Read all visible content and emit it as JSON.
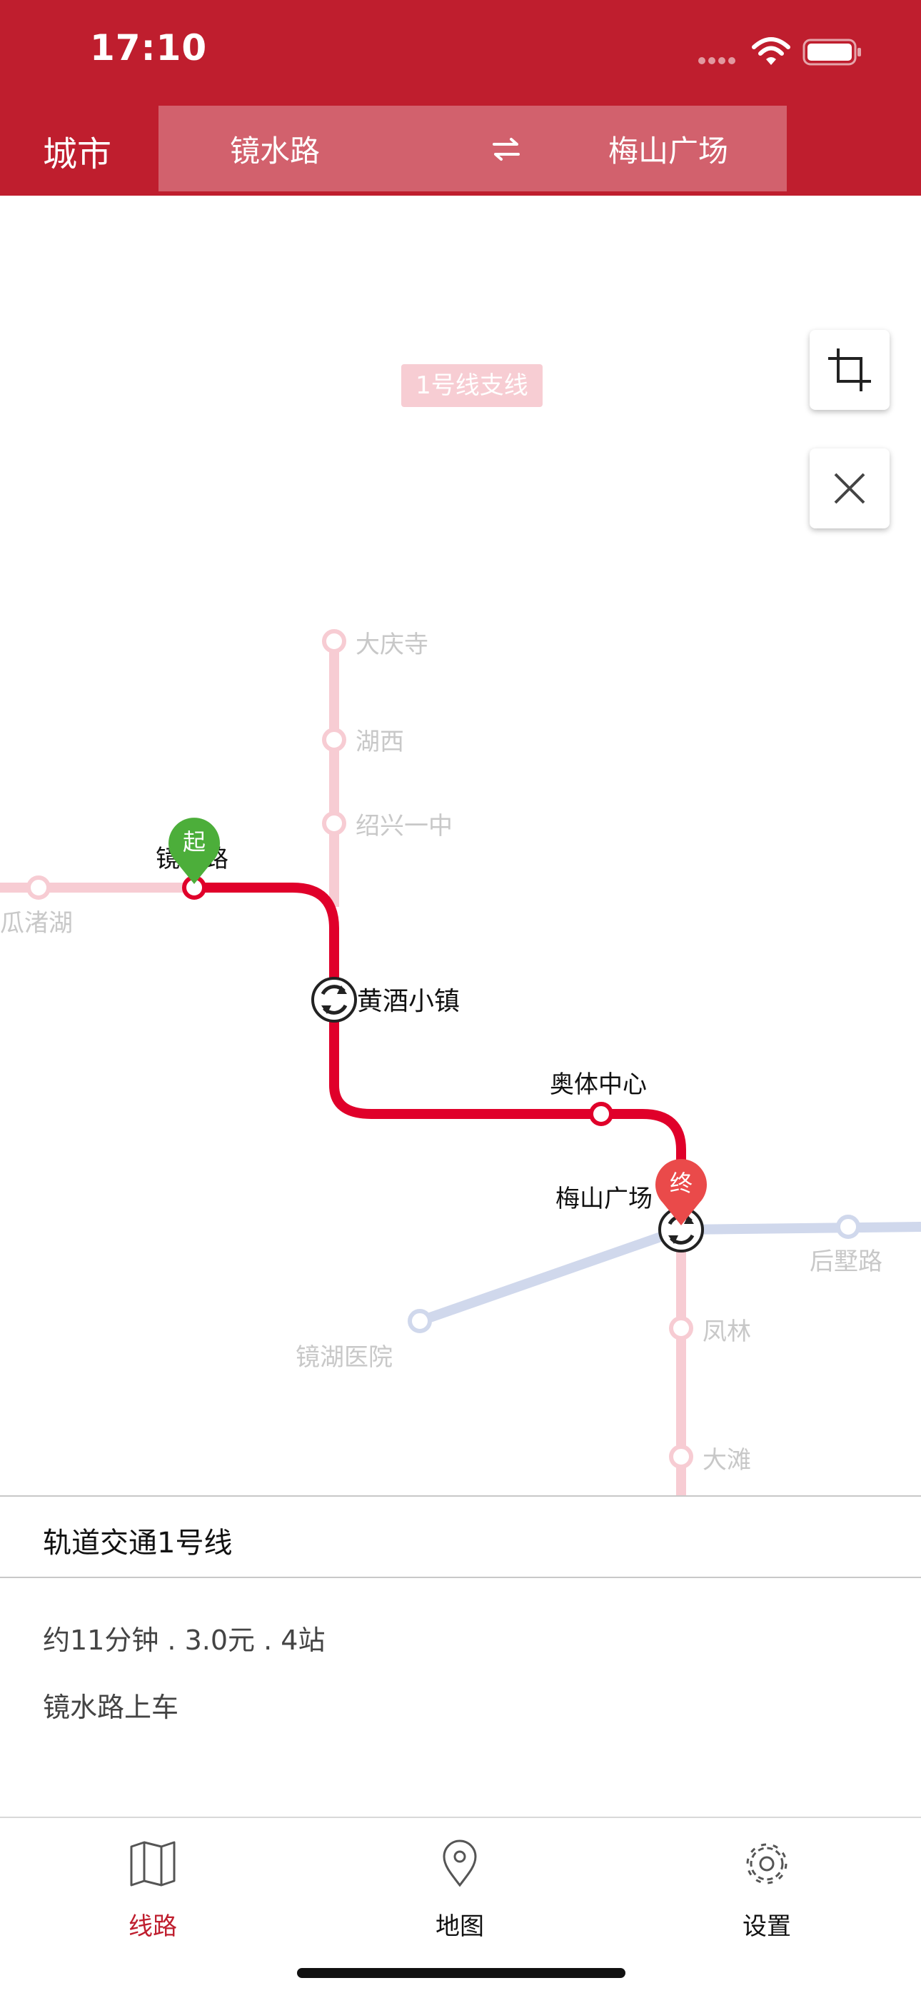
{
  "status_bar": {
    "time": "17:10"
  },
  "header": {
    "city_label": "城市",
    "from_station": "镜水路",
    "to_station": "梅山广场",
    "accent_color": "#bf1e2e"
  },
  "map": {
    "branch_label": "1号线支线",
    "stations": {
      "daqingsi": "大庆寺",
      "huxi": "湖西",
      "shaoxing_yizhong": "绍兴一中",
      "jingshuilu": "镜水路",
      "guazhuhu": "瓜渚湖",
      "huangjiu_xiaozhen": "黄酒小镇",
      "aoti_zhongxin": "奥体中心",
      "meishan_guangchang": "梅山广场",
      "houshulu": "后墅路",
      "jinghu_yiyuan": "镜湖医院",
      "fenglin": "凤林",
      "datan": "大滩"
    },
    "start_marker": "起",
    "end_marker": "终",
    "colors": {
      "route": "#e0002a",
      "line1_faded": "#f7ccd3",
      "other_line": "#d0d8ec",
      "start": "#4cae3a",
      "end": "#ea4a4a"
    }
  },
  "panel": {
    "line_name": "轨道交通1号线",
    "summary": "约11分钟 . 3.0元 . 4站",
    "boarding": "镜水路上车"
  },
  "tabs": [
    {
      "label": "线路",
      "icon": "map-book-icon",
      "active": true
    },
    {
      "label": "地图",
      "icon": "location-pin-icon",
      "active": false
    },
    {
      "label": "设置",
      "icon": "gear-icon",
      "active": false
    }
  ]
}
